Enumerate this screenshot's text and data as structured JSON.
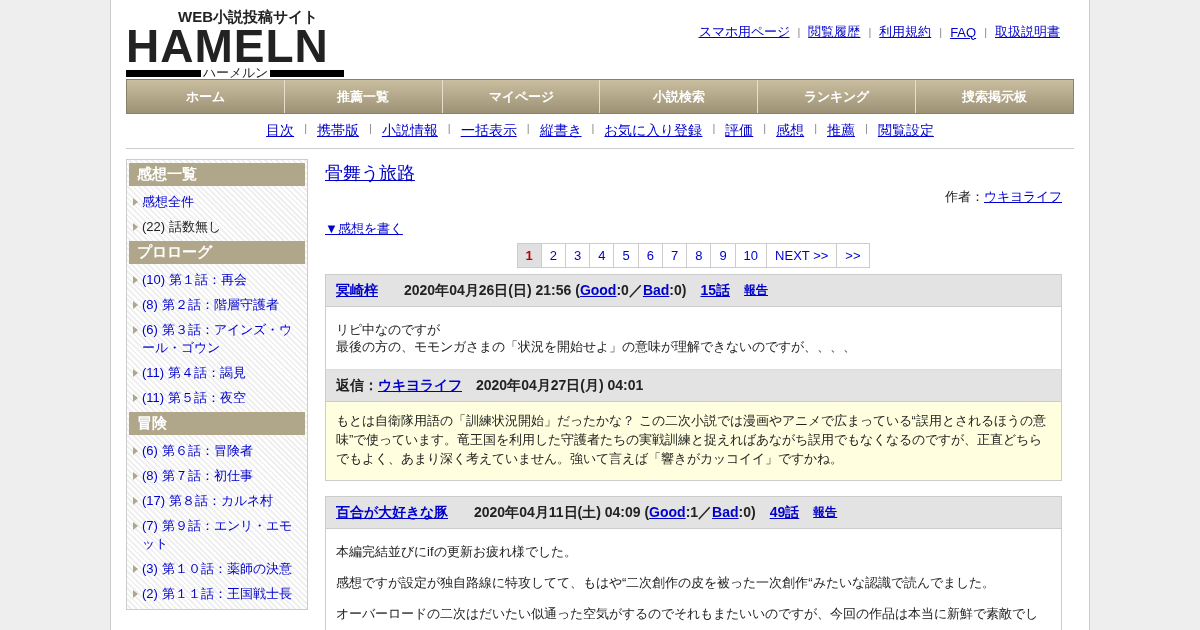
{
  "logo": {
    "tagline": "WEB小説投稿サイト",
    "name": "HAMELN",
    "reading": "ハーメルン"
  },
  "top_links": {
    "separator": "|",
    "items": [
      "スマホ用ページ",
      "閲覧履歴",
      "利用規約",
      "FAQ",
      "取扱説明書"
    ]
  },
  "main_nav": [
    "ホーム",
    "推薦一覧",
    "マイページ",
    "小説検索",
    "ランキング",
    "捜索掲示板"
  ],
  "sub_nav": {
    "separator": "|",
    "items": [
      "目次",
      "携帯版",
      "小説情報",
      "一括表示",
      "縦書き",
      "お気に入り登録",
      "評価",
      "感想",
      "推薦",
      "閲覧設定"
    ]
  },
  "sidebar": [
    {
      "title": "感想一覧",
      "items": [
        {
          "label": "感想全件",
          "kind": "link"
        },
        {
          "label": "(22) 話数無し",
          "kind": "plain"
        }
      ]
    },
    {
      "title": "プロローグ",
      "items": [
        {
          "label": "(10) 第１話：再会",
          "kind": "link"
        },
        {
          "label": "(8) 第２話：階層守護者",
          "kind": "link"
        },
        {
          "label": "(6) 第３話：アインズ・ウール・ゴウン",
          "kind": "link"
        },
        {
          "label": "(11) 第４話：謁見",
          "kind": "link"
        },
        {
          "label": "(11) 第５話：夜空",
          "kind": "link"
        }
      ]
    },
    {
      "title": "冒険",
      "items": [
        {
          "label": "(6) 第６話：冒険者",
          "kind": "link"
        },
        {
          "label": "(8) 第７話：初仕事",
          "kind": "link"
        },
        {
          "label": "(17) 第８話：カルネ村",
          "kind": "link"
        },
        {
          "label": "(7) 第９話：エンリ・エモット",
          "kind": "link"
        },
        {
          "label": "(3) 第１０話：薬師の決意",
          "kind": "link"
        },
        {
          "label": "(2) 第１１話：王国戦士長",
          "kind": "link"
        }
      ]
    }
  ],
  "novel": {
    "title": "骨舞う旅路",
    "author_label": "作者：",
    "author": "ウキヨライフ",
    "write_link": "▼感想を書く"
  },
  "pagination": [
    {
      "label": "1",
      "selected": true
    },
    {
      "label": "2",
      "selected": false
    },
    {
      "label": "3",
      "selected": false
    },
    {
      "label": "4",
      "selected": false
    },
    {
      "label": "5",
      "selected": false
    },
    {
      "label": "6",
      "selected": false
    },
    {
      "label": "7",
      "selected": false
    },
    {
      "label": "8",
      "selected": false
    },
    {
      "label": "9",
      "selected": false
    },
    {
      "label": "10",
      "selected": false
    },
    {
      "label": "NEXT >>",
      "selected": false
    },
    {
      "label": ">>",
      "selected": false
    }
  ],
  "comments": [
    {
      "author": "冥崎梓",
      "meta_prefix": "2020年04月26日(日) 21:56 (",
      "good": "Good",
      "good_suffix": ":0／",
      "bad": "Bad",
      "bad_suffix": ":0)",
      "episode": "15話",
      "report": "報告",
      "paragraphs": [
        [
          "リピ中なのですが",
          "最後の方の、モモンガさまの「状況を開始せよ」の意味が理解できないのですが、、、、"
        ]
      ],
      "reply": {
        "label": "返信：",
        "author": "ウキヨライフ",
        "date": "2020年04月27日(月) 04:01",
        "body": "もとは自衛隊用語の「訓練状況開始」だったかな？ この二次小説では漫画やアニメで広まっている“誤用とされるほうの意味”で使っています。竜王国を利用した守護者たちの実戦訓練と捉えればあながち誤用でもなくなるのですが、正直どちらでもよく、あまり深く考えていません。強いて言えば「響きがカッコイイ」ですかね。"
      }
    },
    {
      "author": "百合が大好きな豚",
      "meta_prefix": "2020年04月11日(土) 04:09 (",
      "good": "Good",
      "good_suffix": ":1／",
      "bad": "Bad",
      "bad_suffix": ":0)",
      "episode": "49話",
      "report": "報告",
      "paragraphs": [
        [
          "本編完結並びにifの更新お疲れ様でした。"
        ],
        [
          "感想ですが設定が独自路線に特攻してて、もはや“二次創作の皮を被った一次創作“みたいな認識で読んでました。"
        ],
        [
          "オーバーロードの二次はだいたい似通った空気がするのでそれもまたいいのですが、今回の作品は本当に新鮮で素敵でし"
        ]
      ]
    }
  ]
}
